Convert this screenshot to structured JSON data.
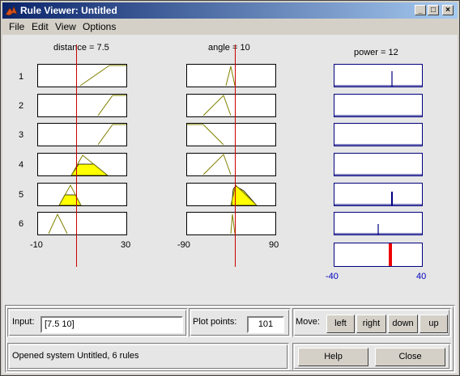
{
  "window": {
    "title": "Rule Viewer: Untitled"
  },
  "menu": {
    "file": "File",
    "edit": "Edit",
    "view": "View",
    "options": "Options"
  },
  "inputs": [
    {
      "label": "distance = 7.5",
      "range_min": "-10",
      "range_max": "30",
      "value": 7.5
    },
    {
      "label": "angle = 10",
      "range_min": "-90",
      "range_max": "90",
      "value": 10
    }
  ],
  "output": {
    "label": "power = 12",
    "range_min": "-40",
    "range_max": "40",
    "value": 12
  },
  "rules": [
    "1",
    "2",
    "3",
    "4",
    "5",
    "6"
  ],
  "bottom": {
    "input_label": "Input:",
    "input_value": "[7.5 10]",
    "plot_points_label": "Plot points:",
    "plot_points_value": "101",
    "move_label": "Move:",
    "move_left": "left",
    "move_right": "right",
    "move_down": "down",
    "move_up": "up",
    "status": "Opened system Untitled, 6 rules",
    "help": "Help",
    "close": "Close"
  },
  "colors": {
    "title_start": "#0a246a",
    "title_end": "#a6caf0",
    "fill": "#ffff00",
    "indicator": "#cc0000",
    "output_line": "#00007f",
    "mf_line": "#808000"
  }
}
